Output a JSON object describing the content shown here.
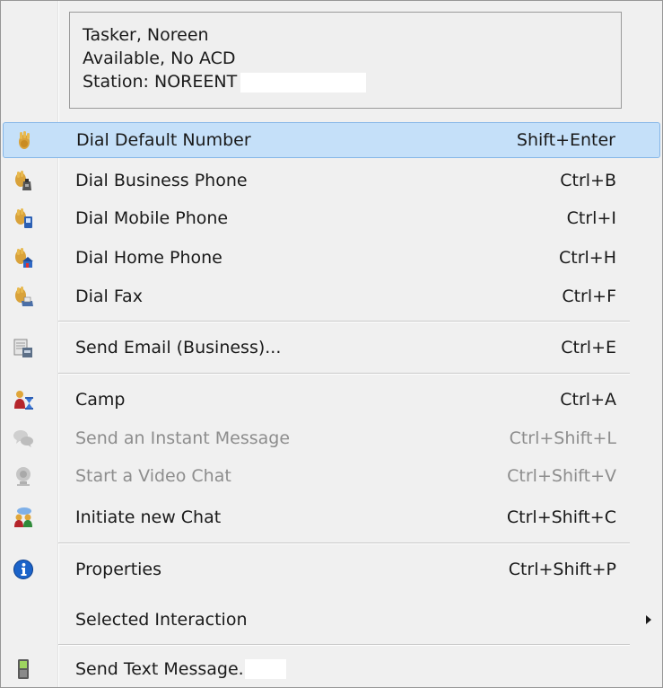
{
  "header": {
    "name": "Tasker, Noreen",
    "status": "Available, No ACD",
    "station": "Station: NOREENT"
  },
  "items": [
    {
      "label": "Dial Default Number",
      "shortcut": "Shift+Enter",
      "icon": "dial-default-icon",
      "highlighted": true
    },
    {
      "label": "Dial Business Phone",
      "shortcut": "Ctrl+B",
      "icon": "dial-business-icon"
    },
    {
      "label": "Dial Mobile Phone",
      "shortcut": "Ctrl+I",
      "icon": "dial-mobile-icon"
    },
    {
      "label": "Dial Home Phone",
      "shortcut": "Ctrl+H",
      "icon": "dial-home-icon"
    },
    {
      "label": "Dial Fax",
      "shortcut": "Ctrl+F",
      "icon": "dial-fax-icon"
    },
    {
      "label": "Send Email (Business)...",
      "shortcut": "Ctrl+E",
      "icon": "email-icon"
    },
    {
      "label": "Camp",
      "shortcut": "Ctrl+A",
      "icon": "camp-icon"
    },
    {
      "label": "Send an Instant Message",
      "shortcut": "Ctrl+Shift+L",
      "icon": "instant-message-icon",
      "disabled": true
    },
    {
      "label": "Start a Video Chat",
      "shortcut": "Ctrl+Shift+V",
      "icon": "video-chat-icon",
      "disabled": true
    },
    {
      "label": "Initiate new Chat",
      "shortcut": "Ctrl+Shift+C",
      "icon": "chat-icon"
    },
    {
      "label": "Properties",
      "shortcut": "Ctrl+Shift+P",
      "icon": "info-icon"
    },
    {
      "label": "Selected Interaction",
      "shortcut": "",
      "icon": "",
      "submenu": true
    },
    {
      "label": "Send Text Message...",
      "shortcut": "",
      "icon": "text-message-icon"
    }
  ],
  "colors": {
    "highlight_bg": "#c5e0f9",
    "highlight_border": "#86b7e8",
    "disabled_text": "#8d8d8d",
    "menu_bg": "#f0f0f0"
  }
}
